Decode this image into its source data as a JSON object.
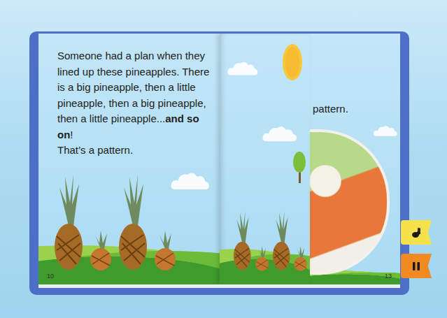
{
  "book": {
    "left_page": {
      "number": "10",
      "paragraph": [
        {
          "text": "Someone had a plan when they lined up these pineapples. There is a big pineapple, then a little pineapple, then a big pineapple, then a little pineapple...",
          "bold": false
        },
        {
          "text": "and so on",
          "bold": true
        },
        {
          "text": "!",
          "bold": false
        }
      ],
      "closing_line": "That’s a pattern.",
      "pineapples": [
        {
          "kind": "big"
        },
        {
          "kind": "little"
        },
        {
          "kind": "big"
        },
        {
          "kind": "little"
        }
      ]
    },
    "turning_page": {
      "pineapples": [
        {
          "kind": "big"
        },
        {
          "kind": "little"
        },
        {
          "kind": "big"
        },
        {
          "kind": "little"
        }
      ]
    },
    "right_page": {
      "number": "13",
      "text": "pattern."
    }
  },
  "controls": [
    {
      "kind": "speed",
      "color": "#f5e14a"
    },
    {
      "kind": "pause",
      "color": "#f28a22"
    }
  ]
}
